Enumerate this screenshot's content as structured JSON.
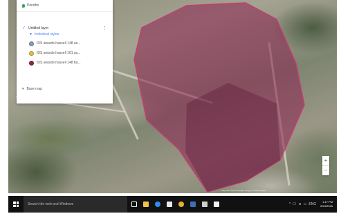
{
  "map": {
    "search_label": "Pondhe",
    "layer": {
      "title": "Untitled layer",
      "style_label": "Individual styles",
      "features": [
        {
          "label": "IDS awards hassell 148 as...",
          "color": "#8e9cb3"
        },
        {
          "label": "IDS awards hassell 161 as...",
          "color": "#e2c24a"
        },
        {
          "label": "IDS awards hassell 148 ba...",
          "color": "#8b2752"
        }
      ]
    },
    "basemap_label": "Base map",
    "zoom_in": "+",
    "zoom_out": "−",
    "attribution": "Map data ©2016 Google  Imagery ©2016 Google",
    "polygon_fill": "#8b2752"
  },
  "taskbar": {
    "search_placeholder": "Search the web and Windows",
    "apps": [
      {
        "name": "task-view-icon",
        "color": "#ffffff"
      },
      {
        "name": "file-explorer-icon",
        "color": "#f2c14e"
      },
      {
        "name": "edge-icon",
        "color": "#2d8cf0"
      },
      {
        "name": "store-icon",
        "color": "#e8e8e8"
      },
      {
        "name": "chrome-icon",
        "color": "#e0b22f"
      },
      {
        "name": "word-icon",
        "color": "#3b6fb6"
      },
      {
        "name": "photos-icon",
        "color": "#cfcfcf"
      },
      {
        "name": "onenote-icon",
        "color": "#f0f0f0"
      }
    ],
    "tray_icons": [
      "^",
      "☐",
      "◄",
      "▭",
      "ENG"
    ],
    "time": "1:17 PM",
    "date": "6/24/2016"
  }
}
